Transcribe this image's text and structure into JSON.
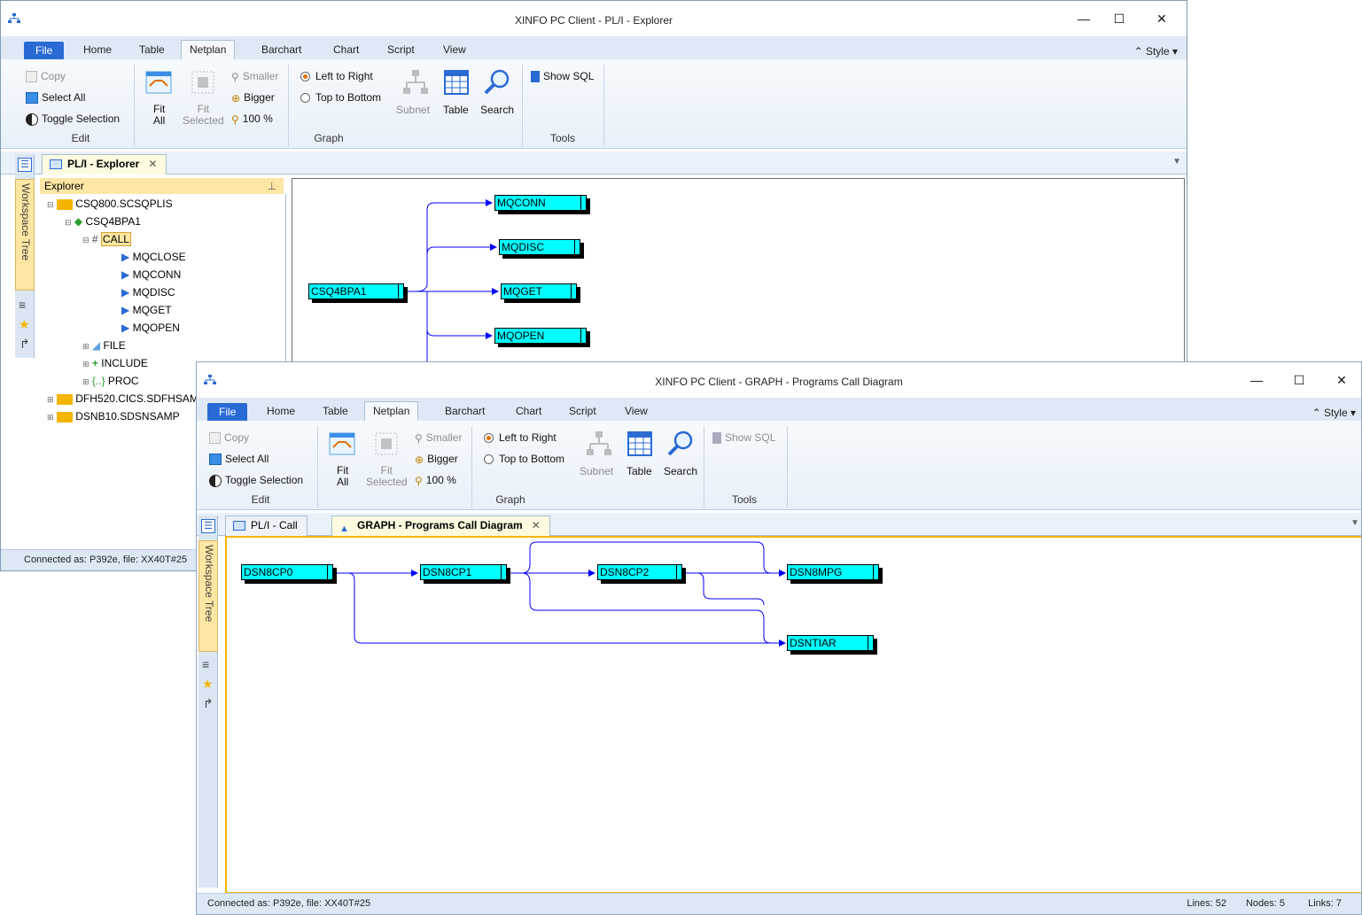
{
  "win1": {
    "title": "XINFO PC Client - PL/I - Explorer",
    "tabs": [
      "File",
      "Home",
      "Table",
      "Netplan",
      "Barchart",
      "Chart",
      "Script",
      "View"
    ],
    "active_tab": "Netplan",
    "style_label": "Style",
    "ribbon": {
      "copy": "Copy",
      "select_all": "Select All",
      "toggle_selection": "Toggle Selection",
      "fit_all_1": "Fit",
      "fit_all_2": "All",
      "fit_sel_1": "Fit",
      "fit_sel_2": "Selected",
      "smaller": "Smaller",
      "bigger": "Bigger",
      "zoom100": "100 %",
      "left_to_right": "Left to Right",
      "top_to_bottom": "Top to Bottom",
      "subnet": "Subnet",
      "table": "Table",
      "search": "Search",
      "show_sql": "Show SQL",
      "group_edit": "Edit",
      "group_graph": "Graph",
      "group_tools": "Tools"
    },
    "doc_tab": "PL/I - Explorer",
    "side_label": "Workspace Tree",
    "panel_title": "Explorer",
    "tree": [
      "CSQ800.SCSQPLIS",
      "CSQ4BPA1",
      "CALL",
      "MQCLOSE",
      "MQCONN",
      "MQDISC",
      "MQGET",
      "MQOPEN",
      "FILE",
      "INCLUDE",
      "PROC",
      "DFH520.CICS.SDFHSAMP",
      "DSNB10.SDSNSAMP"
    ],
    "graph_nodes": {
      "root": "CSQ4BPA1",
      "n1": "MQCONN",
      "n2": "MQDISC",
      "n3": "MQGET",
      "n4": "MQOPEN"
    },
    "status": "Connected as: P392e, file: XX40T#25"
  },
  "win2": {
    "title": "XINFO PC Client - GRAPH - Programs Call Diagram",
    "tabs": [
      "File",
      "Home",
      "Table",
      "Netplan",
      "Barchart",
      "Chart",
      "Script",
      "View"
    ],
    "style_label": "Style",
    "ribbon": {
      "copy": "Copy",
      "select_all": "Select All",
      "toggle_selection": "Toggle Selection",
      "fit_all_1": "Fit",
      "fit_all_2": "All",
      "fit_sel_1": "Fit",
      "fit_sel_2": "Selected",
      "smaller": "Smaller",
      "bigger": "Bigger",
      "zoom100": "100 %",
      "left_to_right": "Left to Right",
      "top_to_bottom": "Top to Bottom",
      "subnet": "Subnet",
      "table": "Table",
      "search": "Search",
      "show_sql": "Show SQL",
      "group_edit": "Edit",
      "group_graph": "Graph",
      "group_tools": "Tools"
    },
    "doc_tab_1": "PL/I - Call",
    "doc_tab_2": "GRAPH - Programs Call Diagram",
    "side_label": "Workspace Tree",
    "graph_nodes": {
      "a": "DSN8CP0",
      "b": "DSN8CP1",
      "c": "DSN8CP2",
      "d": "DSN8MPG",
      "e": "DSNTIAR"
    },
    "status": "Connected as: P392e, file: XX40T#25",
    "status_right": {
      "lines": "Lines: 52",
      "nodes": "Nodes: 5",
      "links": "Links: 7"
    }
  },
  "colors": {
    "accent": "#2a6ad5",
    "node_fill": "#00ffff",
    "edge": "#0000ff"
  }
}
